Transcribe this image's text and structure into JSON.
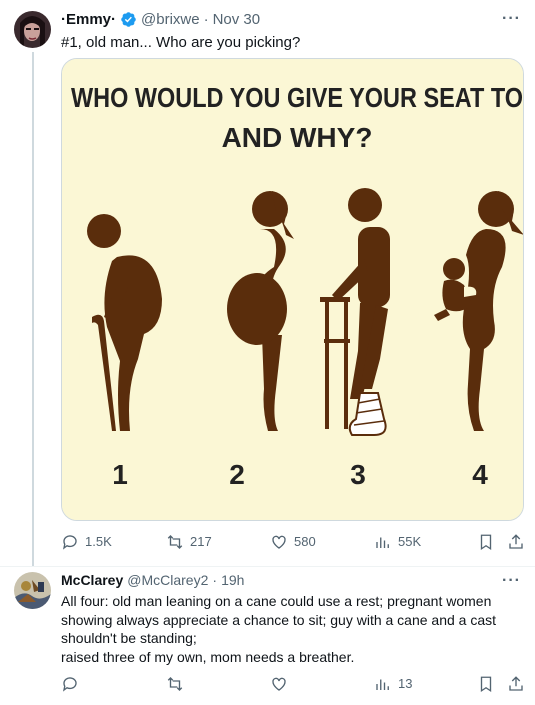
{
  "tweet": {
    "author_name": "·Emmy·",
    "handle": "@brixwe",
    "separator": "·",
    "date": "Nov 30",
    "text": "#1, old man... Who are you picking?",
    "image": {
      "headline_line1": "WHO WOULD YOU GIVE YOUR SEAT TO",
      "headline_line2": "AND WHY?",
      "figure_numbers": [
        "1",
        "2",
        "3",
        "4"
      ],
      "background_color": "#fbf7d5",
      "figure_color": "#5a2d0c"
    },
    "stats": {
      "replies": "1.5K",
      "retweets": "217",
      "likes": "580",
      "views": "55K"
    }
  },
  "reply": {
    "author_name": "McClarey",
    "handle": "@McClarey2",
    "separator": "·",
    "date": "19h",
    "text_lines": [
      "All four:  old man leaning on a cane could use a rest;  pregnant women",
      "showing always appreciate a chance to sit;  guy with a cane and a cast",
      "shouldn't be standing;",
      "raised three of my own, mom needs a breather."
    ],
    "stats": {
      "views": "13"
    }
  },
  "icons": {
    "more": "more-dots-icon",
    "reply": "reply-bubble-icon",
    "retweet": "retweet-icon",
    "like": "heart-icon",
    "views": "views-bars-icon",
    "bookmark": "bookmark-icon",
    "share": "share-icon",
    "verified": "verified-badge-icon"
  },
  "colors": {
    "verified": "#1d9bf0",
    "muted_text": "#536471",
    "primary_text": "#0f1419"
  }
}
